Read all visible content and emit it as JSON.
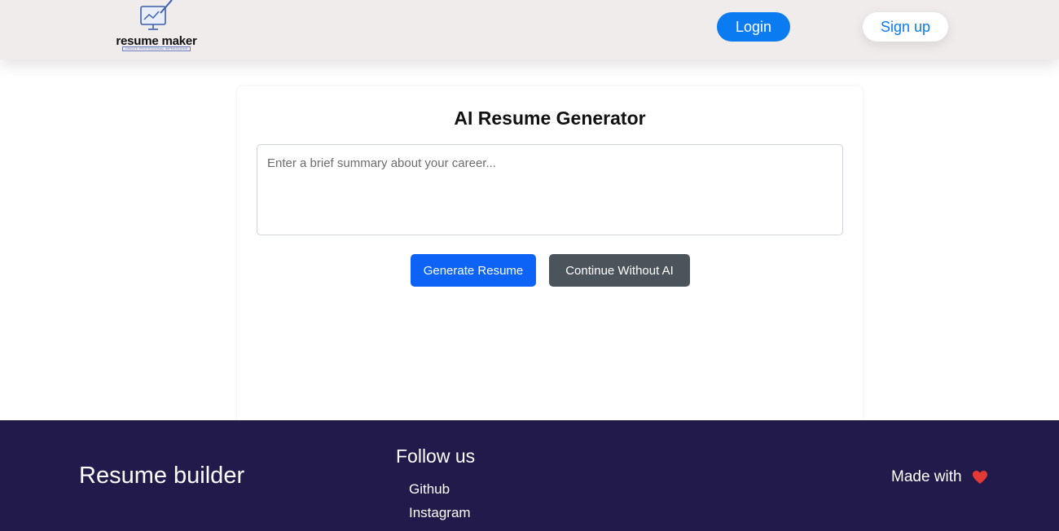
{
  "header": {
    "logo_text": "resume maker",
    "logo_tagline": "CREATE PROFESSIONAL IMPRESSIONS",
    "login_label": "Login",
    "signup_label": "Sign up"
  },
  "main": {
    "title": "AI Resume Generator",
    "summary_placeholder": "Enter a brief summary about your career...",
    "summary_value": "",
    "generate_label": "Generate Resume",
    "continue_label": "Continue Without AI"
  },
  "footer": {
    "brand": "Resume builder",
    "follow_title": "Follow us",
    "links": [
      {
        "label": "Github"
      },
      {
        "label": "Instagram"
      }
    ],
    "made_with": "Made with",
    "heart_icon": "heart-icon"
  },
  "colors": {
    "header_bg": "#f0ecec",
    "primary": "#0a7bf0",
    "generate": "#0d63f5",
    "secondary": "#4b535b",
    "footer_bg": "#221a4b",
    "heart": "#e53935"
  }
}
